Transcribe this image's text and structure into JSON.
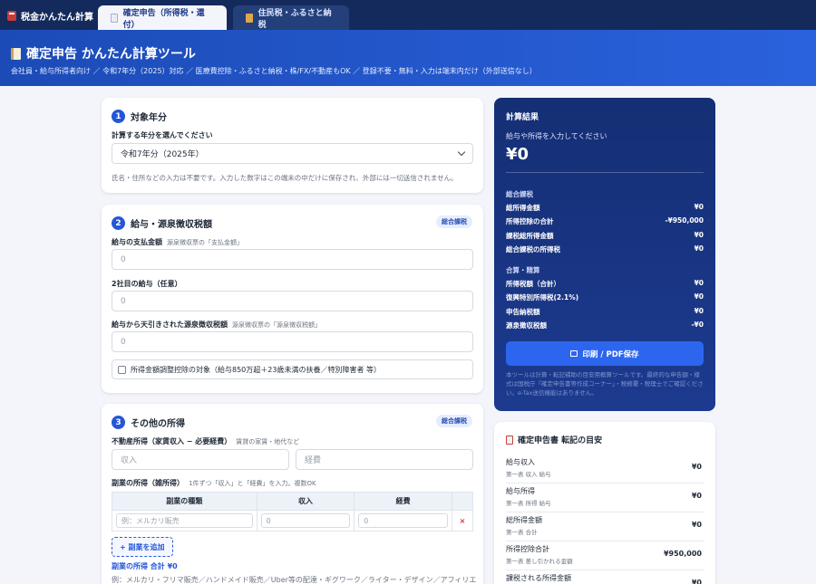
{
  "app": {
    "brand": "税金かんたん計算"
  },
  "tabs": [
    {
      "label": "確定申告（所得税・還付）",
      "active": true
    },
    {
      "label": "住民税・ふるさと納税",
      "active": false
    }
  ],
  "hero": {
    "title": "確定申告 かんたん計算ツール",
    "subtitle": "会社員・給与所得者向け ／ 令和7年分（2025）対応 ／ 医療費控除・ふるさと納税・株/FX/不動産もOK ／ 登録不要・無料・入力は端末内だけ（外部送信なし）"
  },
  "section1": {
    "number": "1",
    "title": "対象年分",
    "label": "計算する年分を選んでください",
    "selected": "令和7年分（2025年）",
    "note": "氏名・住所などの入力は不要です。入力した数字はこの端末の中だけに保存され、外部には一切送信されません。"
  },
  "section2": {
    "number": "2",
    "title": "給与・源泉徴収税額",
    "badge": "総合課税",
    "salary_label": "給与の支払金額",
    "salary_hint": "源泉徴収票の「支払金額」",
    "salary_value": "0",
    "second_label": "2社目の給与（任意）",
    "second_value": "0",
    "withheld_label": "給与から天引きされた源泉徴収税額",
    "withheld_hint": "源泉徴収票の「源泉徴収税額」",
    "withheld_value": "0",
    "checkbox_label": "所得金額調整控除の対象（給与850万超＋23歳未満の扶養／特別障害者 等）"
  },
  "section3": {
    "number": "3",
    "title": "その他の所得",
    "badge": "総合課税",
    "realestate_label": "不動産所得（家賃収入 − 必要経費）",
    "realestate_hint": "賃貸の家賃・地代など",
    "income_placeholder": "収入",
    "expense_placeholder": "経費",
    "side_label": "副業の所得（雑所得）",
    "side_hint": "1件ずつ「収入」と「経費」を入力。複数OK",
    "table_headers": [
      "副業の種類",
      "収入",
      "経費",
      ""
    ],
    "row": {
      "type_placeholder": "例：メルカリ販売",
      "income": "0",
      "expense": "0",
      "delete": "×"
    },
    "add_button": "+ 副業を追加",
    "total": "副業の所得 合計 ¥0",
    "examples": "例：メルカリ・フリマ販売／ハンドメイド販売／Uber等の配達・ギグワーク／ライター・デザイン／アフィリエ"
  },
  "result": {
    "heading": "計算結果",
    "prompt": "給与や所得を入力してください",
    "amount": "¥0",
    "sec1": "総合課税",
    "rows1": [
      {
        "label": "総所得金額",
        "value": "¥0"
      },
      {
        "label": "所得控除の合計",
        "value": "-¥950,000"
      },
      {
        "label": "課税総所得金額",
        "value": "¥0"
      },
      {
        "label": "総合課税の所得税",
        "value": "¥0"
      }
    ],
    "sec2": "合算・精算",
    "rows2": [
      {
        "label": "所得税額（合計）",
        "value": "¥0"
      },
      {
        "label": "復興特別所得税(2.1%)",
        "value": "¥0"
      },
      {
        "label": "申告納税額",
        "value": "¥0"
      },
      {
        "label": "源泉徴収税額",
        "value": "-¥0"
      }
    ],
    "print_button": "印刷 / PDF保存",
    "footnote": "本ツールは計算・転記補助の目安用概算ツールです。最終的な申告額・様式は国税庁「確定申告書等作成コーナー」・税務署・税理士でご確認ください。e-Tax送信機能はありません。"
  },
  "guide": {
    "title": "確定申告書 転記の目安",
    "rows": [
      {
        "label": "給与収入",
        "sub": "第一表 収入 給与",
        "value": "¥0"
      },
      {
        "label": "給与所得",
        "sub": "第一表 所得 給与",
        "value": "¥0"
      },
      {
        "label": "総所得金額",
        "sub": "第一表 合計",
        "value": "¥0"
      },
      {
        "label": "所得控除合計",
        "sub": "第一表 差し引かれる金額",
        "value": "¥950,000"
      },
      {
        "label": "課税される所得金額",
        "sub": "",
        "value": "¥0"
      }
    ]
  },
  "colors": {
    "nav": "#152a5c",
    "hero": "#2456d6",
    "accent": "#2456d6",
    "result_bg": "#1c3a8f",
    "danger": "#d32f2f"
  }
}
